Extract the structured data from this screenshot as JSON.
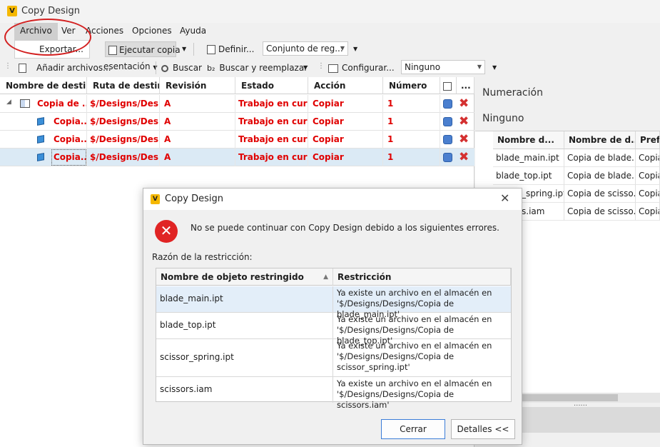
{
  "window": {
    "title": "Copy Design",
    "icon_letter": "V"
  },
  "menu": {
    "items": [
      "Archivo",
      "Ver",
      "Acciones",
      "Opciones",
      "Ayuda"
    ],
    "open_menu": "Archivo",
    "dropdown_items": [
      "Exportar..."
    ]
  },
  "toolbar1": {
    "ejecutar_copia": "Ejecutar copia",
    "definir": "Definir...",
    "conjunto_reglas": "Conjunto de reg..."
  },
  "toolbar2": {
    "anadir": "Añadir archivos...",
    "presentacion": "esentación",
    "buscar": "Buscar",
    "buscar_reemplazar": "Buscar y reemplazar",
    "configurar": "Configurar...",
    "ninguno_combo": "Ninguno"
  },
  "grid": {
    "headers": [
      "Nombre de destino",
      "Ruta de destino",
      "Revisión",
      "Estado",
      "Acción",
      "Número",
      "",
      "..."
    ],
    "rows": [
      {
        "name": "Copia de ...",
        "path": "$/Designs/Des...",
        "rev": "A",
        "state": "Trabajo en curso",
        "action": "Copiar",
        "number": "1"
      },
      {
        "name": "Copia...",
        "path": "$/Designs/Des...",
        "rev": "A",
        "state": "Trabajo en curso",
        "action": "Copiar",
        "number": "1"
      },
      {
        "name": "Copia...",
        "path": "$/Designs/Des...",
        "rev": "A",
        "state": "Trabajo en curso",
        "action": "Copiar",
        "number": "1"
      },
      {
        "name": "Copia...",
        "path": "$/Designs/Des...",
        "rev": "A",
        "state": "Trabajo en curso",
        "action": "Copiar",
        "number": "1"
      }
    ]
  },
  "right_panel": {
    "title": "Numeración",
    "value": "Ninguno",
    "headers": [
      "Nombre d...",
      "Nombre de d...",
      "Prefi"
    ],
    "rows": [
      [
        "blade_main.ipt",
        "Copia de blade...",
        "Copia"
      ],
      [
        "blade_top.ipt",
        "Copia de blade...",
        "Copia"
      ],
      [
        "_spring.ipt",
        "Copia de scisso...",
        "Copia"
      ],
      [
        "s.iam",
        "Copia de scisso...",
        "Copia"
      ]
    ]
  },
  "dialog": {
    "title": "Copy Design",
    "close_glyph": "✕",
    "message": "No se puede continuar con Copy Design debido a los siguientes errores.",
    "reason_label": "Razón de la restricción:",
    "headers": [
      "Nombre de objeto restringido",
      "Restricción"
    ],
    "rows": [
      {
        "name": "blade_main.ipt",
        "restriction": "Ya existe un archivo en el almacén en '$/Designs/Designs/Copia de blade_main.ipt'"
      },
      {
        "name": "blade_top.ipt",
        "restriction": "Ya existe un archivo en el almacén en '$/Designs/Designs/Copia de blade_top.ipt'"
      },
      {
        "name": "scissor_spring.ipt",
        "restriction": "Ya existe un archivo en el almacén en '$/Designs/Designs/Copia de scissor_spring.ipt'"
      },
      {
        "name": "scissors.iam",
        "restriction": "Ya existe un archivo en el almacén en '$/Designs/Designs/Copia de scissors.iam'"
      }
    ],
    "btn_close": "Cerrar",
    "btn_details": "Detalles <<"
  }
}
